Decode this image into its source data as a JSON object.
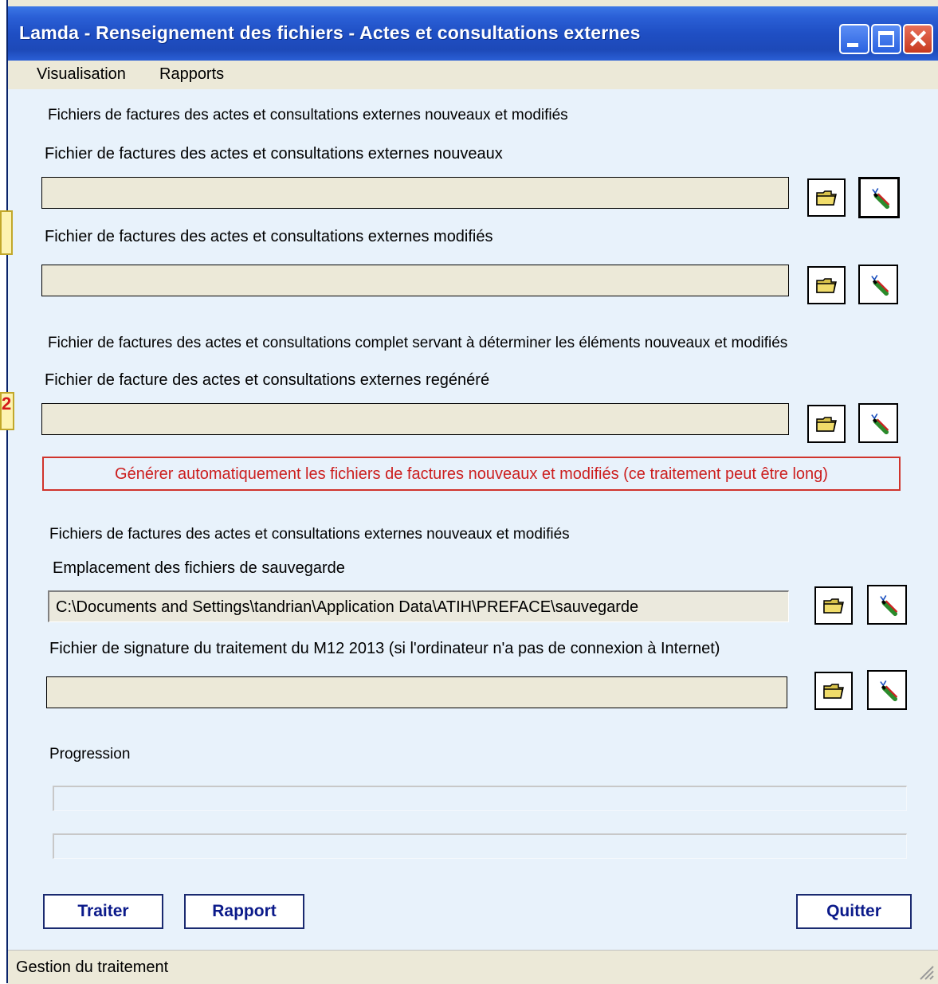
{
  "window": {
    "title": "Lamda - Renseignement des fichiers - Actes et consultations externes"
  },
  "menu": [
    "Visualisation",
    "Rapports"
  ],
  "section1": {
    "heading": "Fichiers de factures des actes et consultations externes nouveaux et modifiés",
    "field_new_label": "Fichier de factures des actes et consultations externes nouveaux",
    "field_new_value": "",
    "field_mod_label": "Fichier de factures des actes et consultations externes modifiés",
    "field_mod_value": ""
  },
  "section2": {
    "heading": "Fichier de factures des actes et consultations complet servant à déterminer les éléments nouveaux et modifiés",
    "field_regen_label": "Fichier de facture des actes et consultations externes regénéré",
    "field_regen_value": "",
    "generate_label": "Générer automatiquement les fichiers de factures nouveaux et modifiés (ce traitement peut être long)"
  },
  "section3": {
    "heading": "Fichiers de factures des actes et consultations externes nouveaux et modifiés",
    "backup_label": "Emplacement des fichiers de sauvegarde",
    "backup_value": "C:\\Documents and Settings\\tandrian\\Application Data\\ATIH\\PREFACE\\sauvegarde",
    "signature_label": "Fichier de signature du traitement du M12 2013 (si l'ordinateur n'a pas de connexion à Internet)",
    "signature_value": ""
  },
  "progress": {
    "label": "Progression",
    "bar1": 0,
    "bar2": 0
  },
  "buttons": {
    "traiter": "Traiter",
    "rapport": "Rapport",
    "quitter": "Quitter"
  },
  "status": "Gestion du traitement",
  "markers": [
    "2"
  ],
  "colors": {
    "title_bar": "#1f4fc4",
    "panel": "#e8f2fb",
    "generate_text": "#cc1e1e",
    "button_text": "#0b1a8a"
  }
}
